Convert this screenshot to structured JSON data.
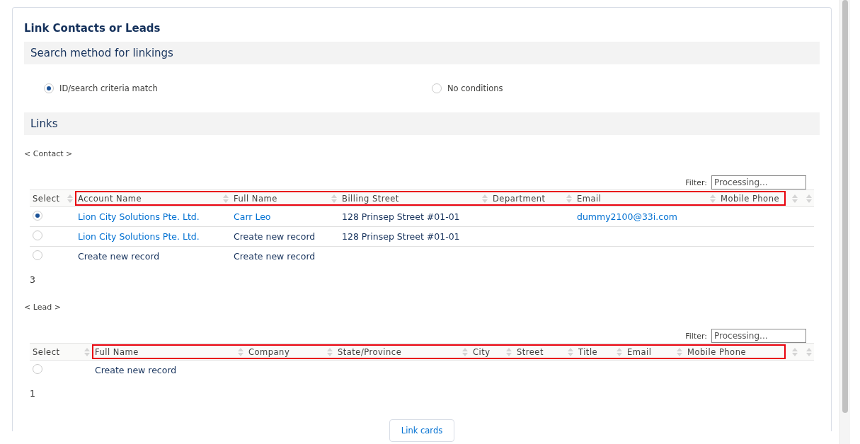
{
  "title": "Link Contacts or Leads",
  "search_section": {
    "heading": "Search method for linkings",
    "options": [
      {
        "label": "ID/search criteria match",
        "selected": true
      },
      {
        "label": "No conditions",
        "selected": false
      }
    ]
  },
  "links_section": {
    "heading": "Links",
    "tables": [
      {
        "label": "< Contact >",
        "filter": {
          "label": "Filter:",
          "placeholder": "Processing..."
        },
        "highlighted": true,
        "columns": [
          "Select",
          "Account Name",
          "Full Name",
          "Billing Street",
          "Department",
          "Email",
          "Mobile Phone"
        ],
        "rows": [
          {
            "selected": true,
            "cells": [
              "",
              {
                "text": "Lion City Solutions Pte. Ltd.",
                "link": true
              },
              {
                "text": "Carr Leo",
                "link": true
              },
              {
                "text": "128 Prinsep Street #01-01",
                "link": false
              },
              "",
              {
                "text": "dummy2100@33i.com",
                "link": true
              },
              ""
            ]
          },
          {
            "selected": false,
            "cells": [
              "",
              {
                "text": "Lion City Solutions Pte. Ltd.",
                "link": true
              },
              {
                "text": "Create new record",
                "link": false
              },
              {
                "text": "128 Prinsep Street #01-01",
                "link": false
              },
              "",
              "",
              ""
            ]
          },
          {
            "selected": false,
            "cells": [
              "",
              {
                "text": "Create new record",
                "link": false
              },
              {
                "text": "Create new record",
                "link": false
              },
              "",
              "",
              "",
              ""
            ]
          }
        ],
        "count": "3"
      },
      {
        "label": "< Lead >",
        "filter": {
          "label": "Filter:",
          "placeholder": "Processing..."
        },
        "highlighted": true,
        "columns": [
          "Select",
          "Full Name",
          "Company",
          "State/Province",
          "City",
          "Street",
          "Title",
          "Email",
          "Mobile Phone"
        ],
        "rows": [
          {
            "selected": false,
            "cells": [
              "",
              {
                "text": "Create new record",
                "link": false
              },
              "",
              "",
              "",
              "",
              "",
              "",
              ""
            ]
          }
        ],
        "count": "1"
      }
    ]
  },
  "button": "Link cards"
}
